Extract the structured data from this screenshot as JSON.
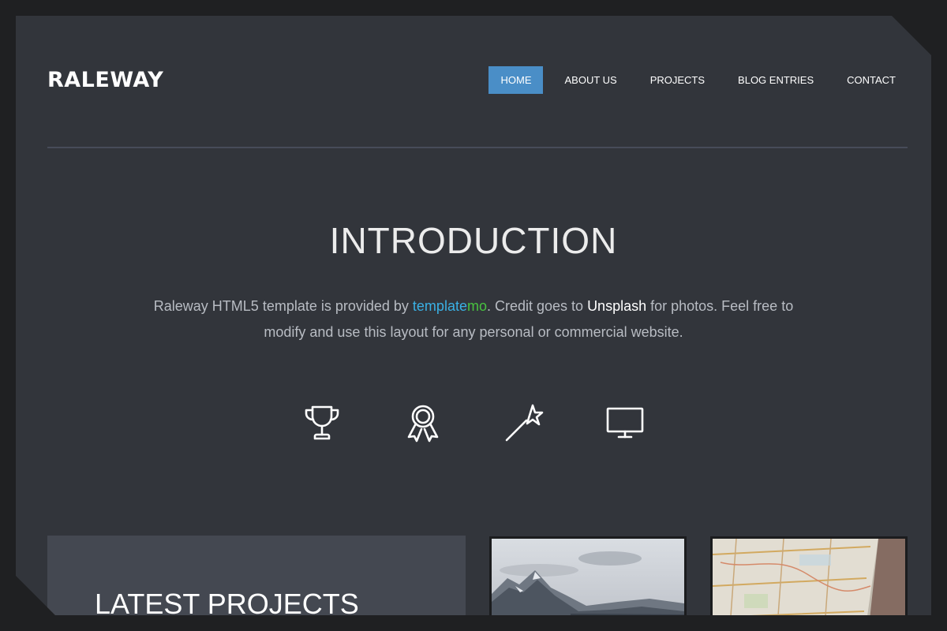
{
  "site": {
    "logo": "RALEWAY"
  },
  "nav": {
    "items": [
      {
        "label": "HOME",
        "active": true
      },
      {
        "label": "ABOUT US",
        "active": false
      },
      {
        "label": "PROJECTS",
        "active": false
      },
      {
        "label": "BLOG ENTRIES",
        "active": false
      },
      {
        "label": "CONTACT",
        "active": false
      }
    ]
  },
  "intro": {
    "title": "INTRODUCTION",
    "text_before": "Raleway HTML5 template is provided by ",
    "link_templatemo_part1": "template",
    "link_templatemo_part2": "mo",
    "text_middle": ". Credit goes to ",
    "link_unsplash": "Unsplash",
    "text_after": " for photos. Feel free to modify and use this layout for any personal or commercial website."
  },
  "features": {
    "icons": [
      "trophy-icon",
      "award-icon",
      "magic-wand-icon",
      "monitor-icon"
    ]
  },
  "projects": {
    "title": "LATEST PROJECTS",
    "thumbnails": [
      "mountain-photo",
      "map-photo"
    ]
  },
  "colors": {
    "page_bg": "#1f2022",
    "panel_bg": "#32353b",
    "accent": "#4a8ec7",
    "templatemo_blue": "#3ab0e4",
    "templatemo_green": "#48c240"
  }
}
